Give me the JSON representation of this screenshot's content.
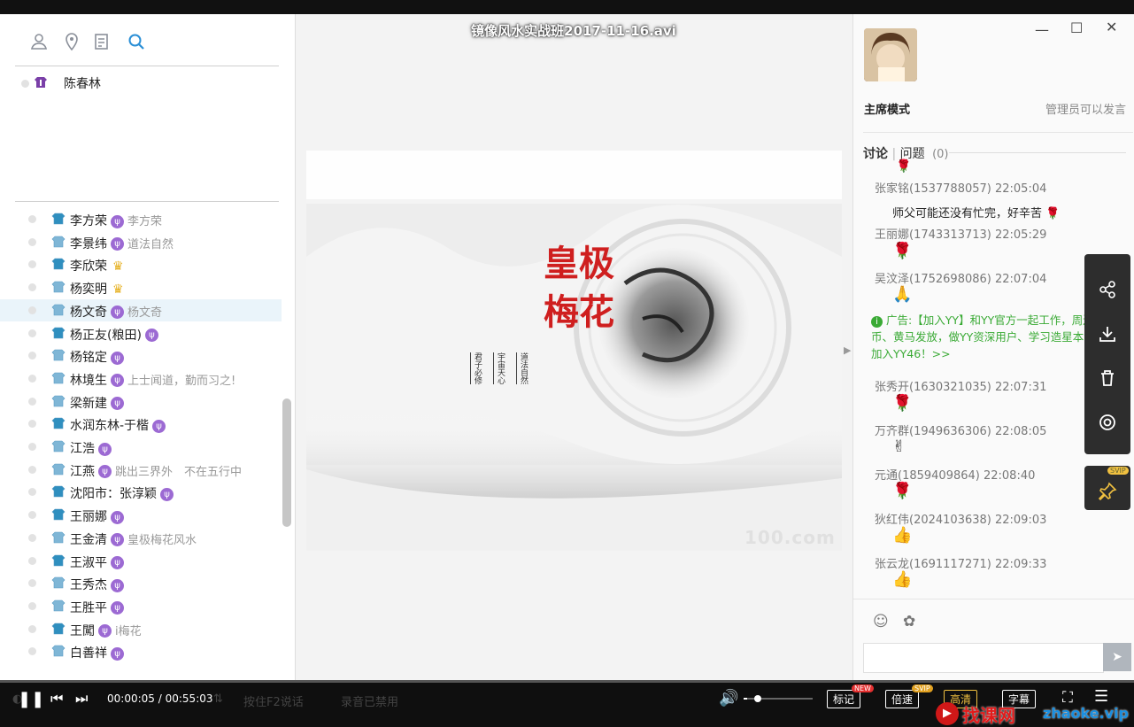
{
  "window": {
    "title": "镜像风水实战班2017-11-16.avi",
    "controls": [
      "minimize-icon",
      "maximize-icon",
      "close-icon"
    ]
  },
  "left": {
    "toolbar_icons": [
      "user-icon",
      "location-icon",
      "note-icon",
      "search-icon"
    ],
    "admin": {
      "name": "陈春林"
    },
    "members": [
      {
        "name": "李方荣",
        "mic": true,
        "sig": "李方荣",
        "shirt": "#2f8fbf"
      },
      {
        "name": "李景纬",
        "mic": true,
        "sig": "道法自然",
        "shirt": "#7fb6d6"
      },
      {
        "name": "李欣荣",
        "mic": false,
        "crown": true,
        "sig": "",
        "shirt": "#2f8fbf"
      },
      {
        "name": "杨奕明",
        "mic": false,
        "crown": true,
        "sig": "",
        "shirt": "#7fb6d6"
      },
      {
        "name": "杨文奇",
        "mic": true,
        "sig": "杨文奇",
        "shirt": "#7fb6d6",
        "selected": true
      },
      {
        "name": "杨正友(粮田)",
        "mic": true,
        "sig": "",
        "shirt": "#2f8fbf"
      },
      {
        "name": "杨铭定",
        "mic": true,
        "sig": "",
        "shirt": "#7fb6d6"
      },
      {
        "name": "林境生",
        "mic": true,
        "sig": "上士闻道，勤而习之!",
        "shirt": "#7fb6d6"
      },
      {
        "name": "梁新建",
        "mic": true,
        "sig": "",
        "shirt": "#7fb6d6"
      },
      {
        "name": "水润东林-于楷",
        "mic": true,
        "sig": "",
        "shirt": "#2f8fbf"
      },
      {
        "name": "江浩",
        "mic": true,
        "sig": "",
        "shirt": "#7fb6d6"
      },
      {
        "name": "江燕",
        "mic": true,
        "sig": "跳出三界外　不在五行中",
        "shirt": "#7fb6d6"
      },
      {
        "name": "沈阳市：张淳颖",
        "mic": true,
        "sig": "",
        "shirt": "#2f8fbf"
      },
      {
        "name": "王丽娜",
        "mic": true,
        "sig": "",
        "shirt": "#2f8fbf"
      },
      {
        "name": "王金清",
        "mic": true,
        "sig": "皇极梅花风水",
        "shirt": "#7fb6d6"
      },
      {
        "name": "王淑平",
        "mic": true,
        "sig": "",
        "shirt": "#2f8fbf"
      },
      {
        "name": "王秀杰",
        "mic": true,
        "sig": "",
        "shirt": "#7fb6d6"
      },
      {
        "name": "王胜平",
        "mic": true,
        "sig": "",
        "shirt": "#7fb6d6"
      },
      {
        "name": "王闖",
        "mic": true,
        "sig": "i梅花",
        "shirt": "#2f8fbf"
      },
      {
        "name": "白善祥",
        "mic": true,
        "sig": "",
        "shirt": "#7fb6d6"
      }
    ]
  },
  "video": {
    "title_line1": "皇极",
    "title_line2": "梅花",
    "poem": [
      "道法自然",
      "宇宙天心",
      "君子必修"
    ],
    "watermark": "100.com"
  },
  "right": {
    "mode_label": "主席模式",
    "mode_hint": "管理员可以发言",
    "tab_discuss": "讨论",
    "tab_question": "问题",
    "question_count": "(0)",
    "chat": [
      {
        "name": "张家铭(1537788057) 22:05:04",
        "text": "师父可能还没有忙完，好辛苦",
        "emo": "🌹"
      },
      {
        "name": "王丽娜(1743313713) 22:05:29",
        "text": "",
        "emo": "🌹"
      },
      {
        "name": "吴汶泽(1752698086) 22:07:04",
        "text": "",
        "emo": "🙏"
      },
      {
        "name": "张秀开(1630321035) 22:07:31",
        "text": "",
        "emo": "🌹"
      },
      {
        "name": "万齐群(1949636306) 22:08:05",
        "text": "",
        "emo": "✌"
      },
      {
        "name": "元通(1859409864) 22:08:40",
        "text": "",
        "emo": "🌹"
      },
      {
        "name": "狄红伟(2024103638) 22:09:03",
        "text": "",
        "emo": "👍"
      },
      {
        "name": "张云龙(1691117271) 22:09:33",
        "text": "",
        "emo": "👍"
      }
    ],
    "ad": "广告:【加入YY】和YY官方一起工作，周边、Y币、黄马发放，做YY资深用户、学习造星本领！快加入YY46！>>"
  },
  "sidebar_icons": [
    "share-icon",
    "download-icon",
    "delete-icon",
    "record-icon",
    "pin-icon"
  ],
  "svip_label": "SVIP",
  "controls": {
    "time_current": "00:00:05",
    "time_sep": "/",
    "time_total": "00:55:03",
    "mark_label": "标记",
    "speed_label": "倍速",
    "quality_label": "高清",
    "subtitle_label": "字幕",
    "new_badge": "NEW",
    "svip_badge": "SVIP",
    "faint_press": "按住F2说话",
    "faint_rec": "录音已禁用",
    "volume": 0.05
  },
  "brand": {
    "text": "找课网",
    "url": "zhaoke.vip"
  }
}
